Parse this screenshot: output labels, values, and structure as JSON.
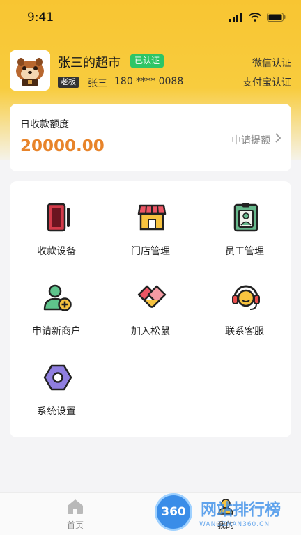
{
  "status_bar": {
    "time": "9:41"
  },
  "profile": {
    "store_name": "张三的超市",
    "verified_badge": "已认证",
    "role_badge": "老板",
    "owner_name": "张三",
    "phone": "180 **** 0088",
    "wechat_auth": "微信认证",
    "alipay_auth": "支付宝认证"
  },
  "quota": {
    "label": "日收款额度",
    "value": "20000.00",
    "apply_label": "申请提额"
  },
  "menu": {
    "items": [
      {
        "label": "收款设备",
        "icon": "pos-device-icon"
      },
      {
        "label": "门店管理",
        "icon": "storefront-icon"
      },
      {
        "label": "员工管理",
        "icon": "employee-badge-icon"
      },
      {
        "label": "申请新商户",
        "icon": "add-merchant-icon"
      },
      {
        "label": "加入松鼠",
        "icon": "handshake-icon"
      },
      {
        "label": "联系客服",
        "icon": "headset-icon"
      },
      {
        "label": "系统设置",
        "icon": "settings-hexagon-icon"
      }
    ]
  },
  "tab_bar": {
    "home_label": "首页",
    "mine_label": "我的"
  },
  "watermark": {
    "logo_text": "360",
    "title": "网站排行榜",
    "url": "WANGZHAN360.CN"
  },
  "colors": {
    "brand_yellow": "#f8c532",
    "accent_orange": "#e8842a",
    "verified_green": "#2ec566"
  }
}
